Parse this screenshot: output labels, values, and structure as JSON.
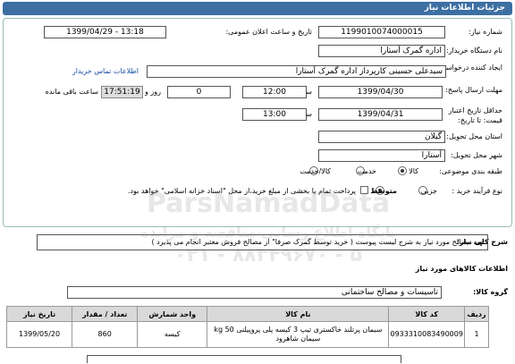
{
  "header": {
    "title": "جزئیات اطلاعات نیاز"
  },
  "fields": {
    "need_number_label": "شماره نیاز:",
    "need_number": "1199010074000015",
    "announce_label": "تاریخ و ساعت اعلان عمومی:",
    "announce_value": "1399/04/29 - 13:18",
    "buyer_label": "نام دستگاه خریدار:",
    "buyer_value": "اداره گمرک آستارا",
    "creator_label": "ایجاد کننده درخواست:",
    "creator_value": "سیدعلی حسینی کارپرداز اداره گمرک آستارا",
    "contact_link": "اطلاعات تماس خریدار",
    "deadline_label": "مهلت ارسال پاسخ: تا تاریخ:",
    "deadline_date": "1399/04/30",
    "time_label": "ساعت",
    "deadline_time": "12:00",
    "days_label": "روز و",
    "days_value": "0",
    "remaining_time": "17:51:19",
    "remaining_label": "ساعت باقی مانده",
    "validity_label": "حداقل تاریخ اعتبار قیمت: تا تاریخ:",
    "validity_date": "1399/04/31",
    "validity_time": "13:00",
    "province_label": "استان محل تحویل:",
    "province_value": "گیلان",
    "city_label": "شهر محل تحویل:",
    "city_value": "آستارا",
    "category_label": "طبقه بندی موضوعی:",
    "category_options": [
      "کالا",
      "خدمت",
      "کالا/خدمت"
    ],
    "process_label": "نوع فرآیند خرید :",
    "process_options": [
      "جزیی",
      "متوسط"
    ],
    "payment_note": "پرداخت تمام یا بخشی از مبلغ خرید،از محل \"اسناد خزانه اسلامی\" خواهد بود."
  },
  "description": {
    "label": "شرح کلی نیاز:",
    "text": "تهیه مصالح مورد نیاز به شرح لیست پیوست ( خرید توسط گمرک صرفا\" از مصالح فروش معتبر انجام می پذیرد )"
  },
  "goods": {
    "section_title": "اطلاعات کالاهای مورد نیاز",
    "group_label": "گروه کالا:",
    "group_value": "تاسیسات و مصالح ساختمانی",
    "columns": [
      "ردیف",
      "کد کالا",
      "نام کالا",
      "واحد شمارش",
      "تعداد / مقدار",
      "تاریخ نیاز"
    ],
    "rows": [
      {
        "index": "1",
        "code": "0933310083490009",
        "name_line1": "سیمان پرتلند خاکستری تیپ 3 کیسه پلی پروپیلنی 50 kg",
        "name_line2": "سیمان شاهرود",
        "unit": "کیسه",
        "qty": "860",
        "date": "1399/05/20"
      }
    ]
  },
  "watermark": {
    "line1": "ParsNamadData",
    "line2": "پایگاه اطلاع رسانی مناقصه و مزایده",
    "line3": "۰۲۱ - ۸۸۳۴۹۶۷۰ - ۵"
  },
  "colors": {
    "header_bg": "#3d6fa3",
    "link": "#1a4fa0",
    "table_header_bg": "#d9d9d9"
  }
}
